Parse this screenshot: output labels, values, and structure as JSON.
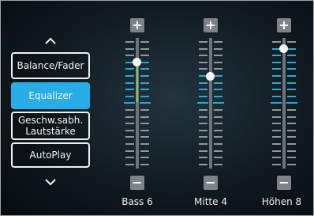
{
  "menu": {
    "up_arrow": "^",
    "down_arrow": "v",
    "items": [
      {
        "label": "Balance/Fader",
        "active": false
      },
      {
        "label": "Equalizer",
        "active": true
      },
      {
        "label_line1": "Geschw.sabh.",
        "label_line2": "Lautstärke",
        "active": false
      },
      {
        "label": "AutoPlay",
        "active": false
      }
    ]
  },
  "controls": {
    "plus": "+",
    "minus": "−"
  },
  "sliders": [
    {
      "name": "Bass",
      "value": 6,
      "label": "Bass 6"
    },
    {
      "name": "Mitte",
      "value": 4,
      "label": "Mitte 4"
    },
    {
      "name": "Höhen",
      "value": 8,
      "label": "Höhen 8"
    }
  ],
  "colors": {
    "accent": "#27aee6",
    "fill": "#8fc65a",
    "tick_blue": "#2aa8d6"
  }
}
